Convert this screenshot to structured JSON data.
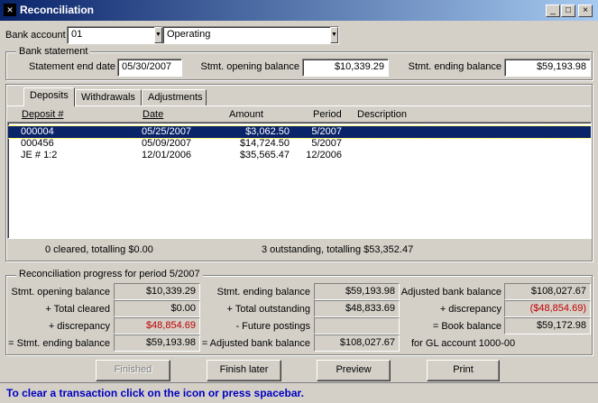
{
  "window": {
    "title": "Reconciliation",
    "minimize": "_",
    "maximize": "□",
    "close": "×"
  },
  "bank": {
    "account_label": "Bank account",
    "account_code": "01",
    "account_name": "Operating"
  },
  "statement": {
    "group_label": "Bank statement",
    "end_date_label": "Statement end date",
    "end_date": "05/30/2007",
    "opening_label": "Stmt. opening balance",
    "opening": "$10,339.29",
    "ending_label": "Stmt. ending balance",
    "ending": "$59,193.98"
  },
  "tabs": [
    "Deposits",
    "Withdrawals",
    "Adjustments"
  ],
  "table": {
    "headers": {
      "deposit": "Deposit #",
      "date": "Date",
      "amount": "Amount",
      "period": "Period",
      "description": "Description"
    },
    "rows": [
      {
        "deposit": "000004",
        "date": "05/25/2007",
        "amount": "$3,062.50",
        "period": "5/2007",
        "description": ""
      },
      {
        "deposit": "000456",
        "date": "05/09/2007",
        "amount": "$14,724.50",
        "period": "5/2007",
        "description": ""
      },
      {
        "deposit": "JE # 1:2",
        "date": "12/01/2006",
        "amount": "$35,565.47",
        "period": "12/2006",
        "description": ""
      }
    ],
    "cleared_summary": "0  cleared, totalling $0.00",
    "outstanding_summary": "3 outstanding, totalling $53,352.47"
  },
  "progress": {
    "group_label": "Reconciliation progress for period  5/2007",
    "col1": [
      {
        "label": "Stmt. opening balance",
        "value": "$10,339.29"
      },
      {
        "label": "+ Total cleared",
        "value": "$0.00"
      },
      {
        "label": "+ discrepancy",
        "value": "$48,854.69"
      },
      {
        "label": "= Stmt. ending balance",
        "value": "$59,193.98"
      }
    ],
    "col2": [
      {
        "label": "Stmt. ending balance",
        "value": "$59,193.98"
      },
      {
        "label": "+ Total outstanding",
        "value": "$48,833.69"
      },
      {
        "label": "- Future postings",
        "value": ""
      },
      {
        "label": "= Adjusted bank balance",
        "value": "$108,027.67"
      }
    ],
    "col3": [
      {
        "label": "Adjusted bank balance",
        "value": "$108,027.67"
      },
      {
        "label": "+ discrepancy",
        "value": "($48,854.69)"
      },
      {
        "label": "= Book balance",
        "value": "$59,172.98"
      },
      {
        "label": "for GL account 1000-00",
        "value": ""
      }
    ]
  },
  "buttons": {
    "finished": "Finished",
    "finish_later": "Finish later",
    "preview": "Preview",
    "print": "Print"
  },
  "status": "To clear a transaction click on the icon or press spacebar.",
  "colors": {
    "title_start": "#0a246a",
    "title_end": "#a6caf0",
    "selection": "#0a246a",
    "discrepancy": "#c00000",
    "status_text": "#0000c0"
  }
}
